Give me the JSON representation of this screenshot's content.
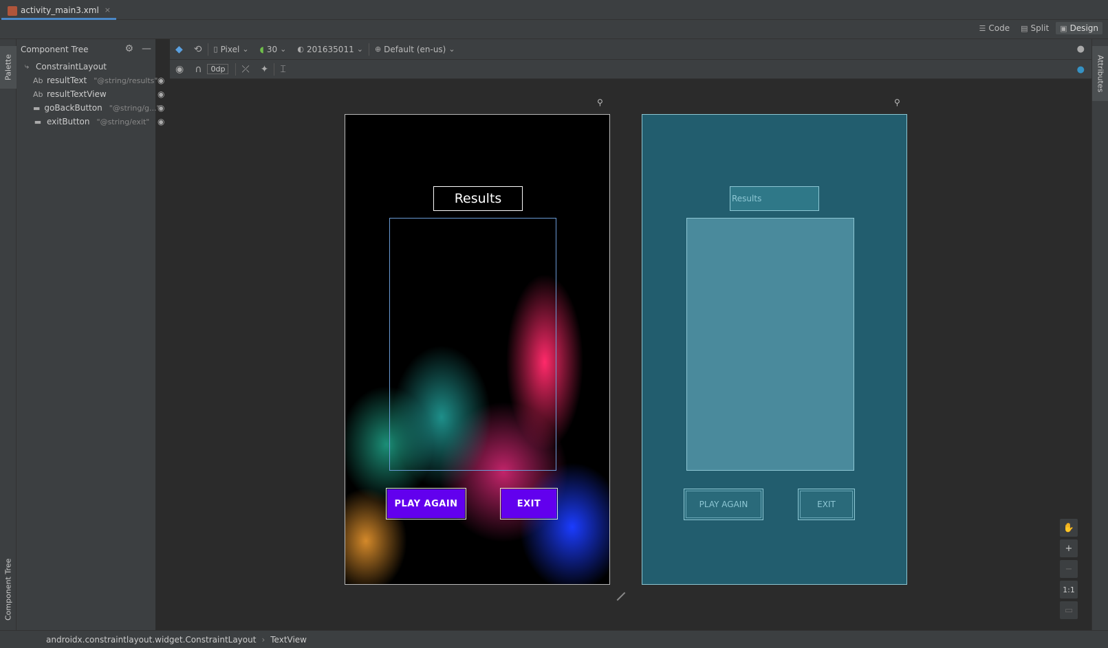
{
  "editor_tab": {
    "filename": "activity_main3.xml",
    "close": "×"
  },
  "view_modes": {
    "code": "Code",
    "split": "Split",
    "design": "Design"
  },
  "side_tabs": {
    "palette": "Palette",
    "component_tree": "Component Tree",
    "attributes": "Attributes"
  },
  "component_tree": {
    "title": "Component Tree",
    "root": "ConstraintLayout",
    "items": [
      {
        "prefix": "Ab",
        "name": "resultText",
        "hint": "\"@string/results\""
      },
      {
        "prefix": "Ab",
        "name": "resultTextView",
        "hint": ""
      },
      {
        "prefix": "",
        "name": "goBackButton",
        "hint": "\"@string/g...\""
      },
      {
        "prefix": "",
        "name": "exitButton",
        "hint": "\"@string/exit\""
      }
    ]
  },
  "toolbar": {
    "device": "Pixel",
    "api": "30",
    "theme": "201635011",
    "locale": "Default (en-us)",
    "margin": "0dp"
  },
  "design": {
    "results_label": "Results",
    "play_again": "PLAY AGAIN",
    "exit": "EXIT"
  },
  "blueprint": {
    "results_label": "Results",
    "play_again": "PLAY AGAIN",
    "exit": "EXIT"
  },
  "zoom": {
    "plus": "+",
    "minus": "−",
    "one_to_one": "1:1"
  },
  "status": {
    "path": "androidx.constraintlayout.widget.ConstraintLayout",
    "leaf": "TextView"
  }
}
